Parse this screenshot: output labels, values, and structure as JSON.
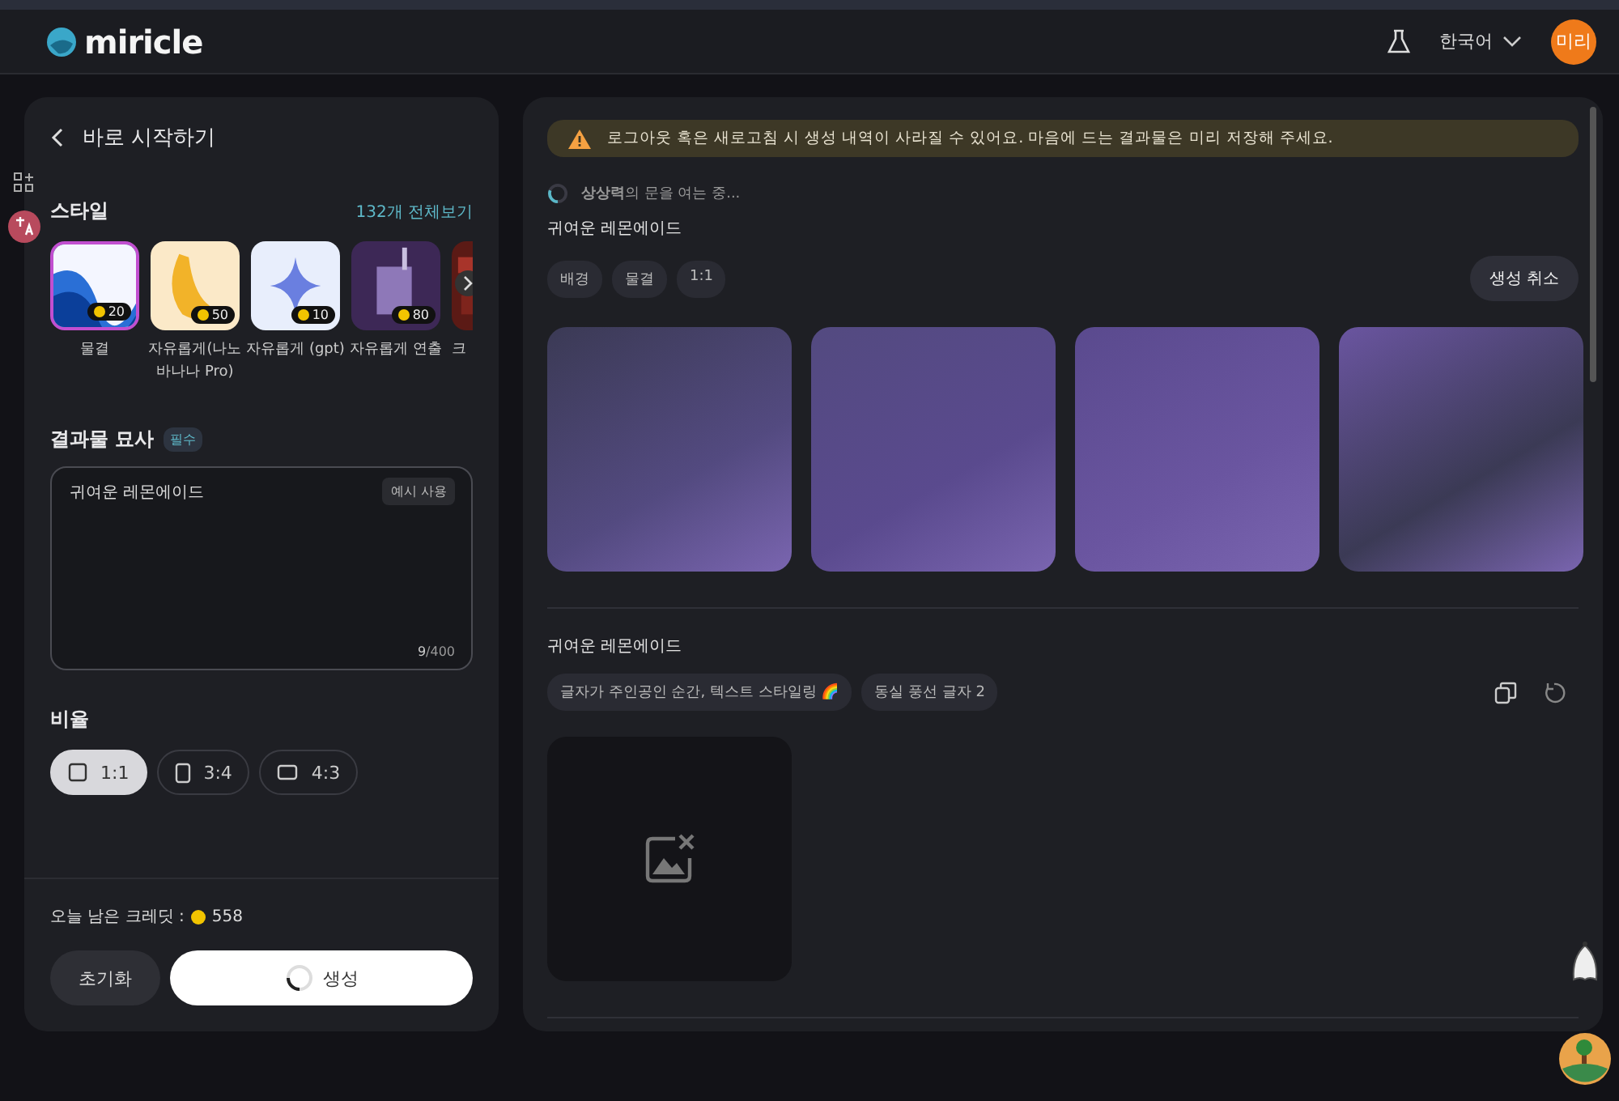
{
  "header": {
    "logo": "miricle",
    "language": "한국어",
    "avatar": "미리"
  },
  "panel": {
    "back_title": "바로 시작하기",
    "style_title": "스타일",
    "style_all": "132개 전체보기",
    "styles": [
      {
        "label": "물결",
        "cost": "20",
        "selected": true
      },
      {
        "label": "자유롭게(나노 바나나 Pro)",
        "cost": "50",
        "selected": false
      },
      {
        "label": "자유롭게 (gpt)",
        "cost": "10",
        "selected": false
      },
      {
        "label": "자유롭게 연출",
        "cost": "80",
        "selected": false
      },
      {
        "label": "크",
        "selected": false
      }
    ],
    "desc_title": "결과물 묘사",
    "required": "필수",
    "desc_value": "귀여운 레몬에이드",
    "example_button": "예시 사용",
    "count_current": "9",
    "count_max": "/400",
    "ratio_title": "비율",
    "ratios": [
      {
        "label": "1:1",
        "kind": "square",
        "selected": true
      },
      {
        "label": "3:4",
        "kind": "portrait",
        "selected": false
      },
      {
        "label": "4:3",
        "kind": "landscape",
        "selected": false
      }
    ],
    "credits_label": "오늘 남은 크레딧 :",
    "credits": "558",
    "reset_button": "초기화",
    "generate_button": "생성"
  },
  "results": {
    "notice": "로그아웃 혹은 새로고침 시 생성 내역이 사라질 수 있어요. 마음에 드는 결과물은 미리 저장해 주세요.",
    "loading": "**상상력**의 문을 여는 중...",
    "groups": [
      {
        "prompt": "귀여운 레몬에이드",
        "tags": [
          "배경",
          "물결",
          "1:1"
        ],
        "cancel": "생성 취소",
        "images": [
          {
            "kind": "loading"
          },
          {
            "kind": "loading"
          },
          {
            "kind": "loading"
          },
          {
            "kind": "loading"
          }
        ]
      },
      {
        "prompt": "귀여운 레몬에이드",
        "tags": [
          "글자가 주인공인 순간, 텍스트 스타일링 🌈",
          "동실 풍선 글자 2"
        ],
        "actions": true,
        "images": [
          {
            "kind": "failed"
          }
        ]
      }
    ]
  }
}
